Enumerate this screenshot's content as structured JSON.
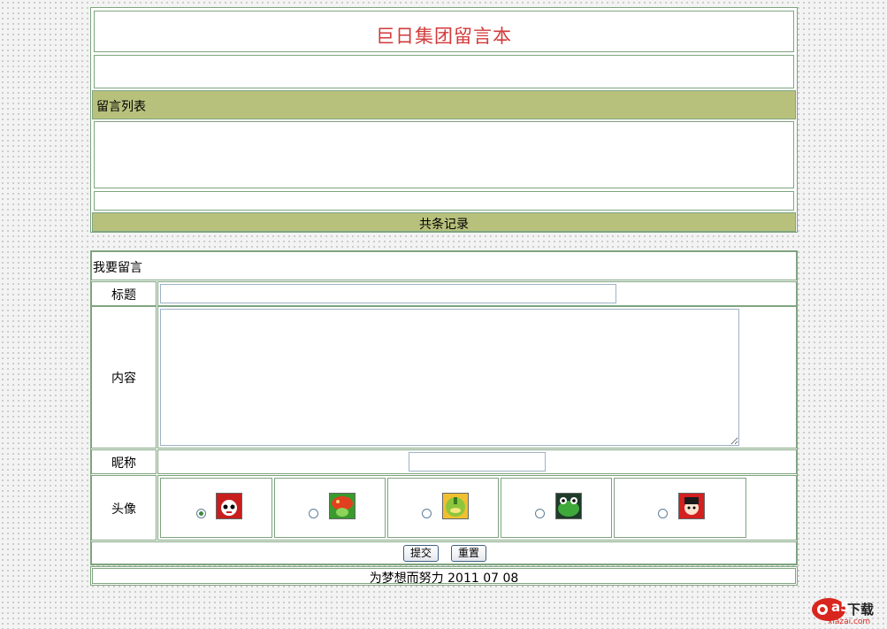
{
  "header": {
    "title": "巨日集团留言本"
  },
  "list": {
    "heading": "留言列表",
    "record_summary": "共条记录"
  },
  "form": {
    "heading": "我要留言",
    "title_label": "标题",
    "title_value": "",
    "content_label": "内容",
    "content_value": "",
    "nickname_label": "昵称",
    "nickname_value": "",
    "avatar_label": "头像",
    "avatars": [
      {
        "icon": "red-face-avatar-icon",
        "selected": true
      },
      {
        "icon": "green-mushroom-avatar-icon",
        "selected": false
      },
      {
        "icon": "yellow-ball-avatar-icon",
        "selected": false
      },
      {
        "icon": "green-frog-avatar-icon",
        "selected": false
      },
      {
        "icon": "red-girl-avatar-icon",
        "selected": false
      }
    ],
    "submit_label": "提交",
    "reset_label": "重置"
  },
  "footer": {
    "text": "为梦想而努力 2011 07 08"
  },
  "watermark": {
    "brand": "a5",
    "label": "下载",
    "site": "xiazai.com"
  }
}
